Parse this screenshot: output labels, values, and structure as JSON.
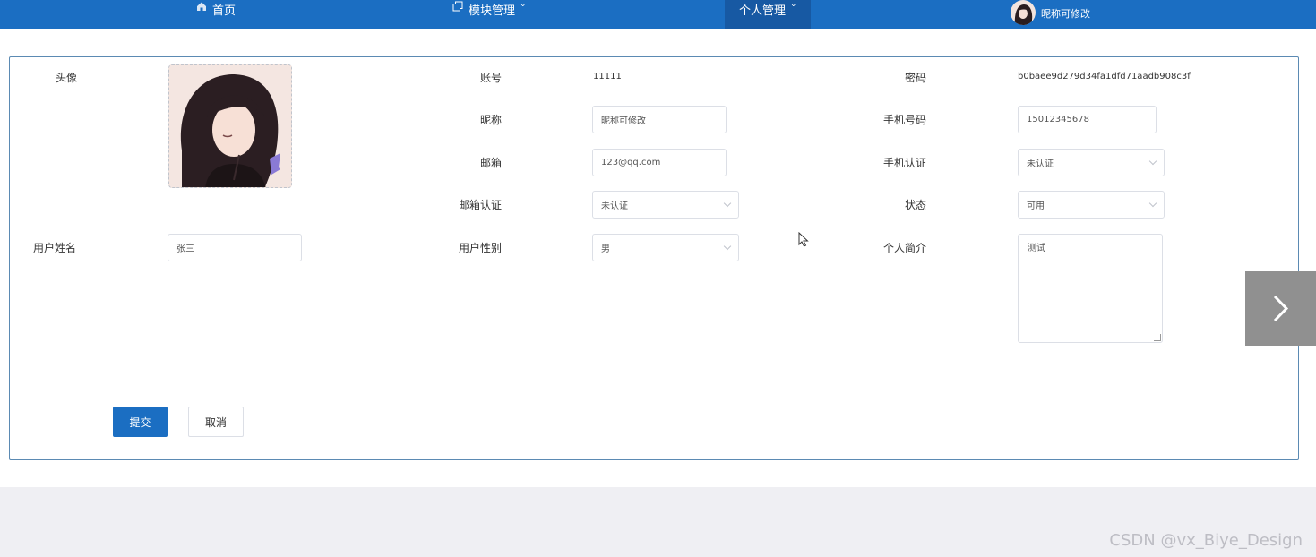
{
  "nav": {
    "home": "首页",
    "modules": "模块管理",
    "personal": "个人管理",
    "nickname": "昵称可修改"
  },
  "form": {
    "avatar_label": "头像",
    "account_label": "账号",
    "account_value": "11111",
    "password_label": "密码",
    "password_value": "b0baee9d279d34fa1dfd71aadb908c3f",
    "nickname_label": "昵称",
    "nickname_value": "昵称可修改",
    "phone_label": "手机号码",
    "phone_value": "15012345678",
    "email_label": "邮箱",
    "email_value": "123@qq.com",
    "phone_verify_label": "手机认证",
    "phone_verify_value": "未认证",
    "email_verify_label": "邮箱认证",
    "email_verify_value": "未认证",
    "status_label": "状态",
    "status_value": "可用",
    "realname_label": "用户姓名",
    "realname_value": "张三",
    "gender_label": "用户性别",
    "gender_value": "男",
    "bio_label": "个人简介",
    "bio_value": "测试"
  },
  "actions": {
    "submit": "提交",
    "cancel": "取消"
  },
  "watermark": "CSDN @vx_Biye_Design",
  "colors": {
    "primary": "#1b6ec2",
    "active_nav": "#1759a3",
    "border": "#dcdfe6"
  }
}
